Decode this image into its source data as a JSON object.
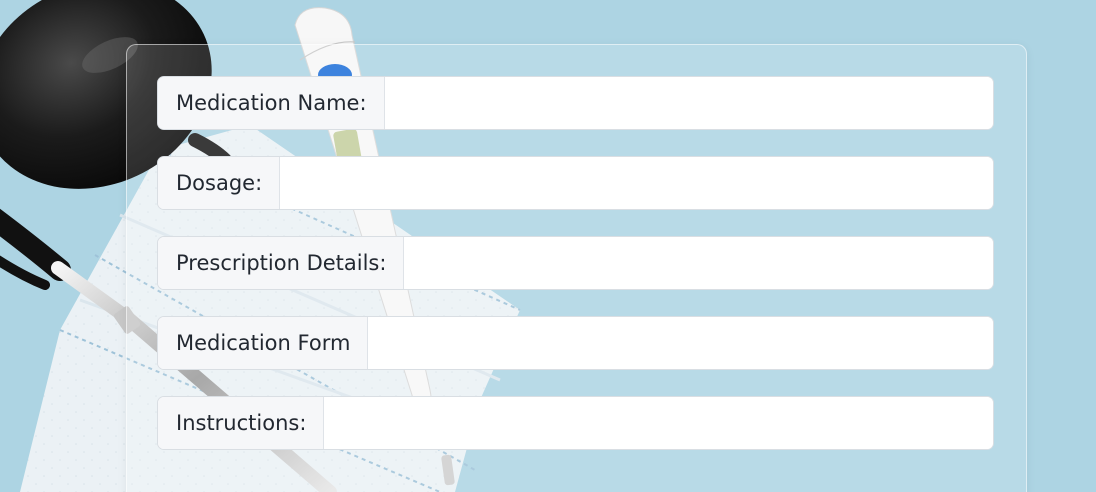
{
  "form": {
    "fields": [
      {
        "label": "Medication Name:",
        "value": ""
      },
      {
        "label": "Dosage:",
        "value": ""
      },
      {
        "label": "Prescription Details:",
        "value": ""
      },
      {
        "label": "Medication Form",
        "value": ""
      },
      {
        "label": "Instructions:",
        "value": ""
      }
    ]
  },
  "colors": {
    "background": "#a9d2e1",
    "field_label_bg": "#f6f7f9",
    "field_bg": "#ffffff",
    "border": "#d9dee3",
    "text": "#222831"
  }
}
